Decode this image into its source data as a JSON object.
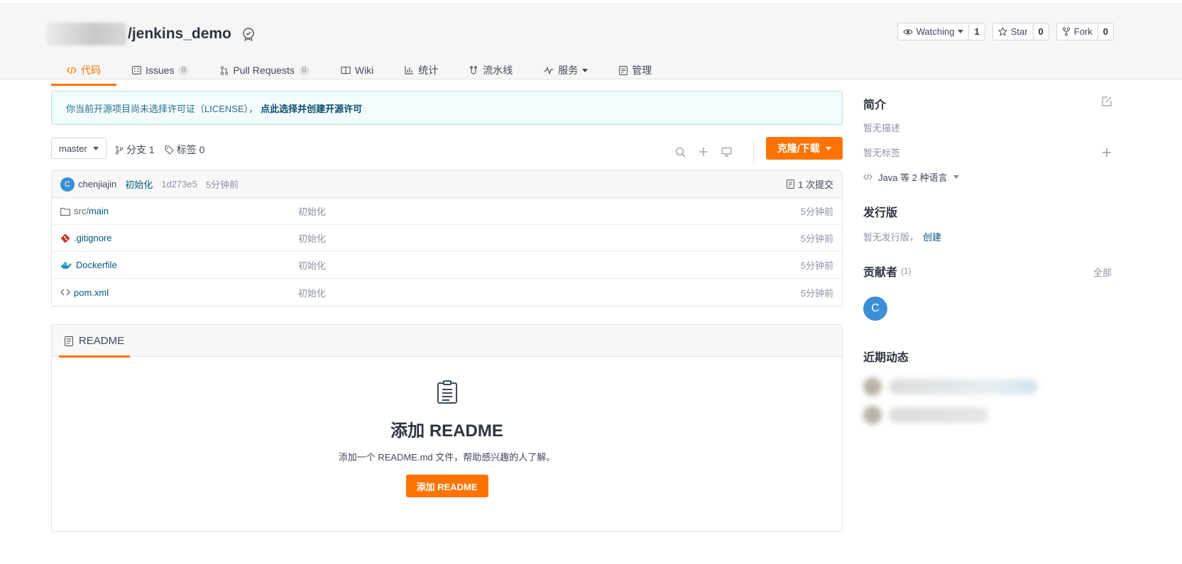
{
  "repo": {
    "name": "/jenkins_demo"
  },
  "actions": {
    "watch": {
      "label": "Watching",
      "count": "1"
    },
    "star": {
      "label": "Star",
      "count": "0"
    },
    "fork": {
      "label": "Fork",
      "count": "0"
    }
  },
  "tabs": [
    {
      "label": "代码",
      "icon": "code-icon",
      "active": true
    },
    {
      "label": "Issues",
      "count": "0",
      "icon": "issues-icon"
    },
    {
      "label": "Pull Requests",
      "count": "0",
      "icon": "pull-request-icon"
    },
    {
      "label": "Wiki",
      "icon": "wiki-icon"
    },
    {
      "label": "统计",
      "icon": "stats-icon"
    },
    {
      "label": "流水线",
      "icon": "pipeline-icon"
    },
    {
      "label": "服务",
      "icon": "service-icon"
    },
    {
      "label": "管理",
      "icon": "manage-icon"
    }
  ],
  "license": {
    "text": "你当前开源项目尚未选择许可证（LICENSE），",
    "link": "点此选择并创建开源许可"
  },
  "toolbar": {
    "branch": "master",
    "branches": "分支 1",
    "tags": "标签 0",
    "clone_label": "克隆/下载"
  },
  "commit": {
    "avatar": "C",
    "author": "chenjiajin",
    "message": "初始化",
    "hash": "1d273e5",
    "time": "5分钟前",
    "count": "1 次提交"
  },
  "files": [
    {
      "prefix": "src/",
      "name": "main",
      "icon": "folder-icon",
      "message": "初始化",
      "time": "5分钟前"
    },
    {
      "prefix": "",
      "name": ".gitignore",
      "icon": "git-icon",
      "message": "初始化",
      "time": "5分钟前"
    },
    {
      "prefix": "",
      "name": "Dockerfile",
      "icon": "docker-icon",
      "message": "初始化",
      "time": "5分钟前"
    },
    {
      "prefix": "",
      "name": "pom.xml",
      "icon": "code-file-icon",
      "message": "初始化",
      "time": "5分钟前"
    }
  ],
  "readme": {
    "tab": "README",
    "title": "添加 README",
    "desc": "添加一个 README.md 文件，帮助感兴趣的人了解。",
    "button": "添加 README"
  },
  "sidebar": {
    "intro_title": "简介",
    "no_desc": "暂无描述",
    "no_tags": "暂无标签",
    "language": "Java 等 2 种语言",
    "release_title": "发行版",
    "no_release": "暂无发行版，",
    "create": "创建",
    "contrib_title": "贡献者",
    "contrib_count": "(1)",
    "all": "全部",
    "contrib_avatar": "C",
    "activity_title": "近期动态"
  },
  "colors": {
    "accent": "#fe7300",
    "link": "#005980",
    "avatar": "#3a8fd6"
  }
}
